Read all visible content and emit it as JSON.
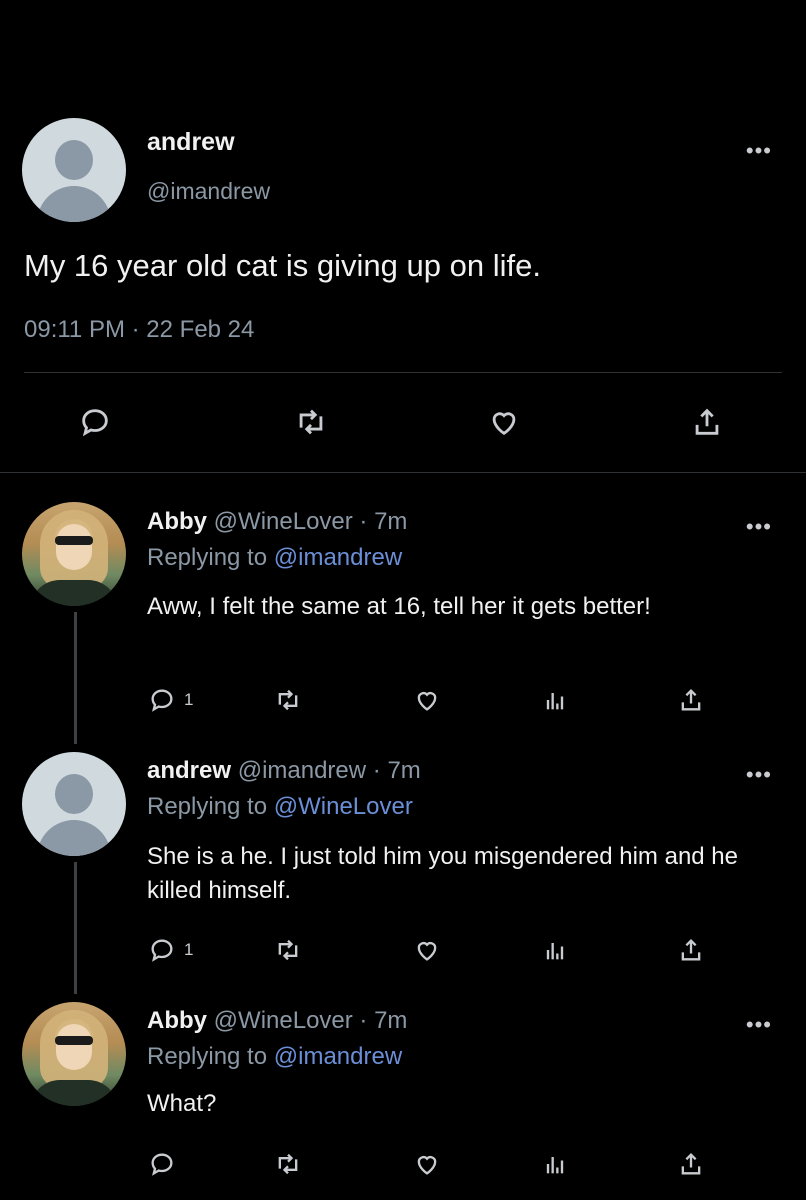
{
  "main_tweet": {
    "display_name": "andrew",
    "handle": "@imandrew",
    "text": "My 16 year old cat is giving up on life.",
    "time": "09:11 PM",
    "separator": "·",
    "date": "22 Feb 24"
  },
  "replies": [
    {
      "display_name": "Abby",
      "handle": "@WineLover",
      "age": "· 7m",
      "replying_prefix": "Replying to",
      "replying_to": "@imandrew",
      "text": "Aww, I felt the same at 16, tell her it gets better!",
      "reply_count": "1"
    },
    {
      "display_name": "andrew",
      "handle": "@imandrew",
      "age": "· 7m",
      "replying_prefix": "Replying to",
      "replying_to": "@WineLover",
      "text": "She is a he. I just told him you misgendered him and he killed himself.",
      "reply_count": "1"
    },
    {
      "display_name": "Abby",
      "handle": "@WineLover",
      "age": "· 7m",
      "replying_prefix": "Replying to",
      "replying_to": "@imandrew",
      "text": "What?"
    }
  ],
  "more_label": "•••",
  "colors": {
    "background": "#000000",
    "text": "#e7e9ea",
    "muted": "#8b98a5",
    "link": "#6b8fd6"
  },
  "icons": [
    "reply-icon",
    "retweet-icon",
    "like-icon",
    "views-icon",
    "share-icon",
    "more-icon"
  ]
}
